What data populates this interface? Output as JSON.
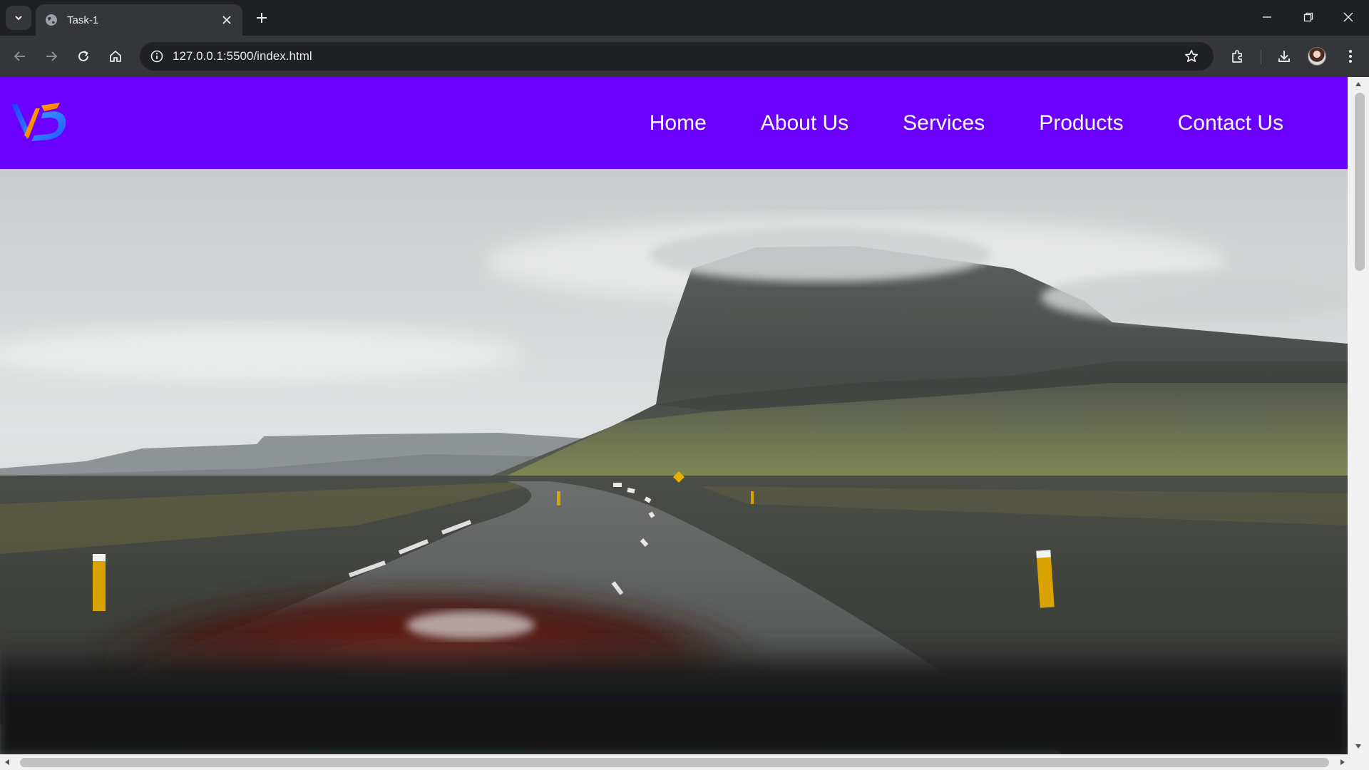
{
  "browser": {
    "tab": {
      "title": "Task-1"
    },
    "address_bar": {
      "url": "127.0.0.1:5500/index.html"
    }
  },
  "site": {
    "header_color": "#6b00ff",
    "logo_icon": "vs-logo-icon",
    "nav": [
      {
        "label": "Home"
      },
      {
        "label": "About Us"
      },
      {
        "label": "Services"
      },
      {
        "label": "Products"
      },
      {
        "label": "Contact Us"
      }
    ],
    "hero_image": "road-to-mountain-landscape"
  }
}
